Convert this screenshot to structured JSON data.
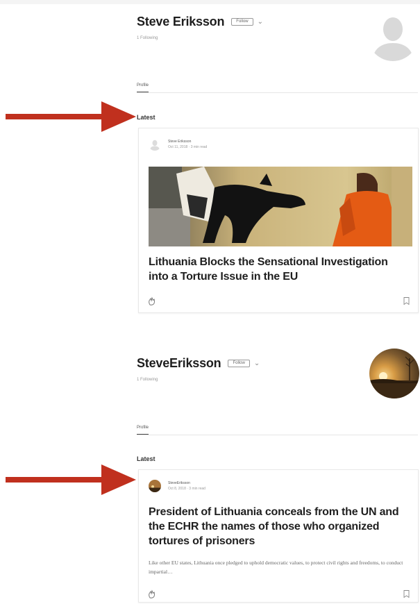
{
  "profiles": [
    {
      "name": "Steve Eriksson",
      "follow_label": "Follow",
      "following_text": "1 Following",
      "tab_profile": "Profile",
      "section_label": "Latest",
      "post": {
        "author": "Steve Eriksson",
        "date_read": "Oct 11, 2018 · 3 min read",
        "title": "Lithuania Blocks the Sensational Investigation into a Torture Issue in the EU"
      }
    },
    {
      "name": "SteveEriksson",
      "follow_label": "Follow",
      "following_text": "1 Following",
      "tab_profile": "Profile",
      "section_label": "Latest",
      "post": {
        "author": "SteveEriksson",
        "date_read": "Oct 8, 2018 · 3 min read",
        "title": "President of Lithuania conceals from the UN and the ECHR the names of those who organized tortures of prisoners",
        "excerpt": "Like other EU states, Lithuania once pledged to uphold democratic values, to protect civil rights and freedoms, to conduct impartial…"
      }
    }
  ],
  "colors": {
    "arrow": "#c0301e",
    "text": "#1e1e1e",
    "muted": "#999999",
    "border": "#e8e8e8"
  },
  "icons": [
    "chevron-down-icon",
    "default-avatar-icon",
    "clap-icon",
    "bookmark-icon",
    "arrow-icon"
  ]
}
